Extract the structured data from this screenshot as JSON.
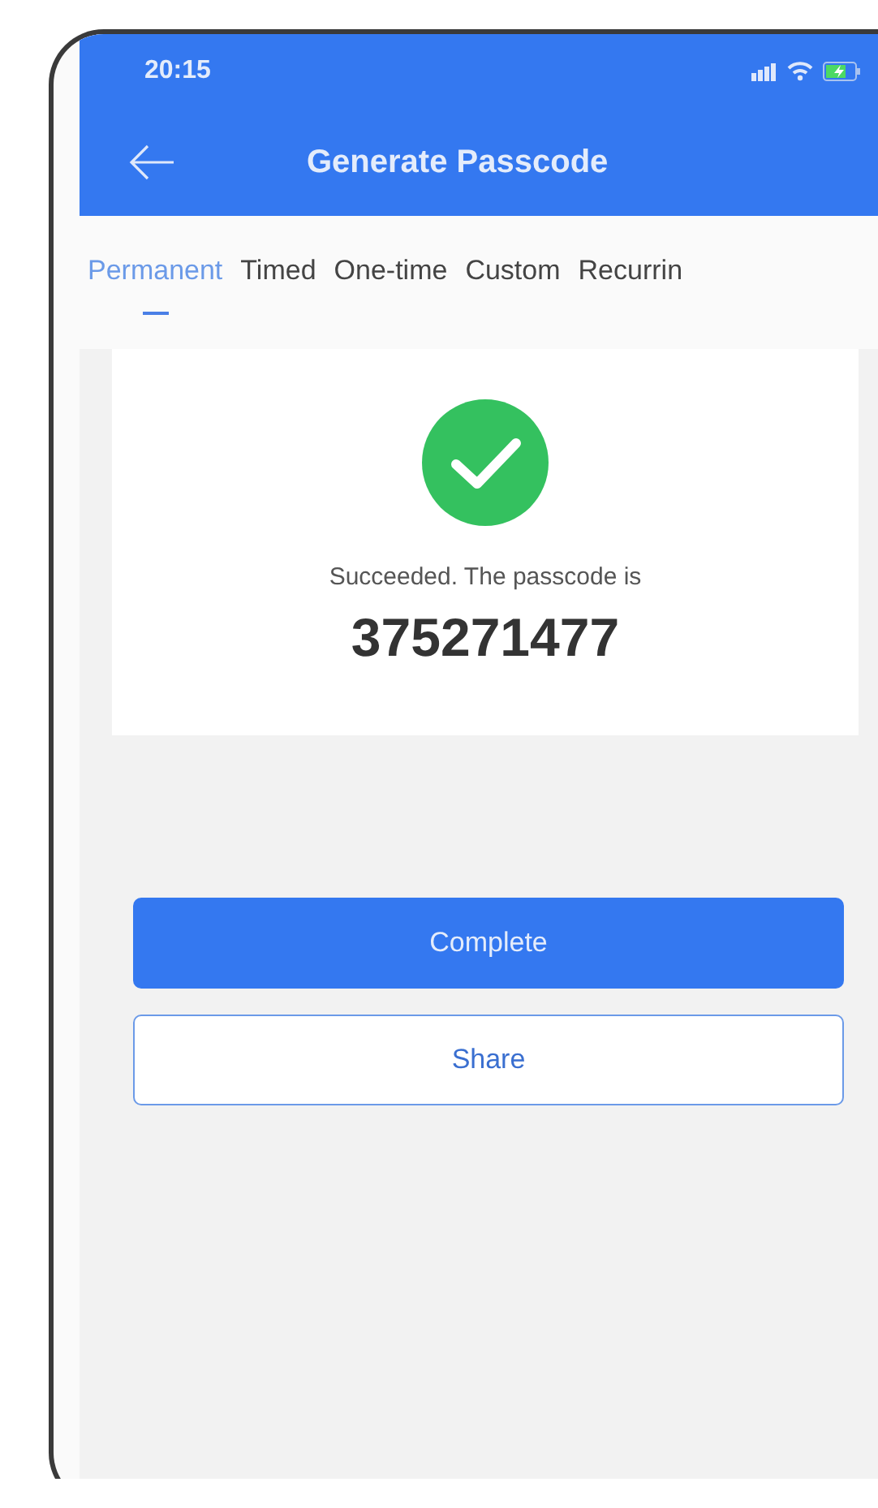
{
  "status_bar": {
    "time": "20:15"
  },
  "nav_bar": {
    "title": "Generate Passcode"
  },
  "tabs": [
    {
      "label": "Permanent",
      "selected": true
    },
    {
      "label": "Timed",
      "selected": false
    },
    {
      "label": "One-time",
      "selected": false
    },
    {
      "label": "Custom",
      "selected": false
    },
    {
      "label": "Recurrin",
      "selected": false
    }
  ],
  "result": {
    "message": "Succeeded. The passcode is",
    "passcode": "375271477"
  },
  "buttons": [
    {
      "label": "Complete",
      "kind": "primary"
    },
    {
      "label": "Share",
      "kind": "outline"
    }
  ]
}
